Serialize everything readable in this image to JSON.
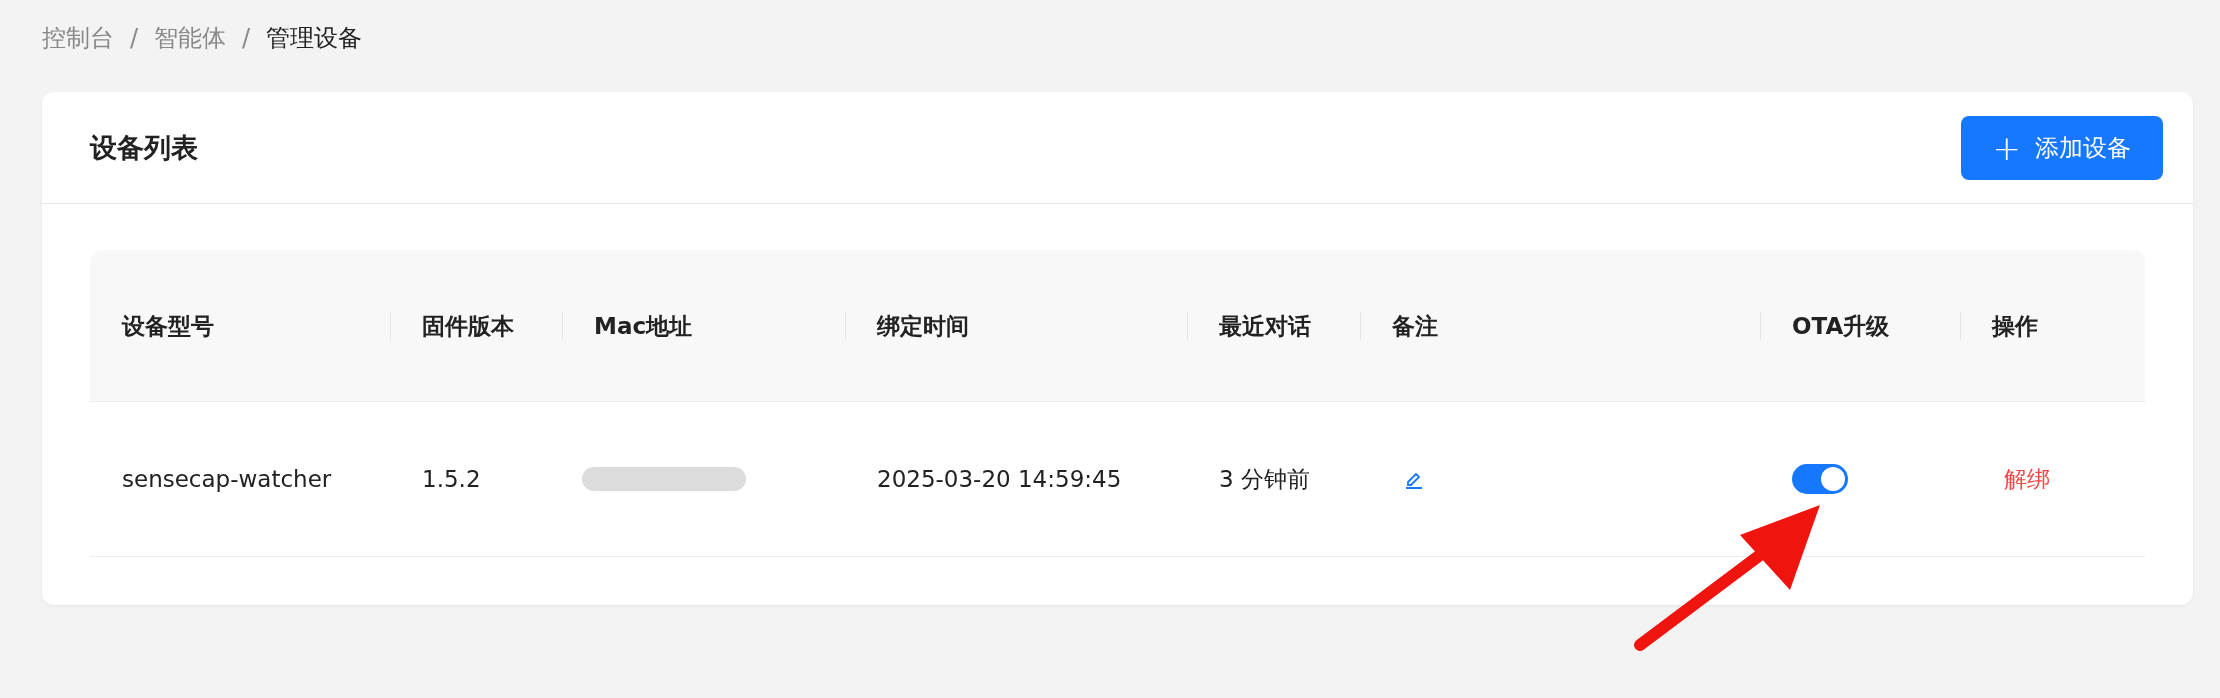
{
  "breadcrumb": [
    {
      "label": "控制台",
      "current": false
    },
    {
      "label": "智能体",
      "current": false
    },
    {
      "label": "管理设备",
      "current": true
    }
  ],
  "separator": "/",
  "card": {
    "title": "设备列表",
    "add_button": {
      "icon": "+",
      "label": "添加设备"
    }
  },
  "table": {
    "columns": [
      "设备型号",
      "固件版本",
      "Mac地址",
      "绑定时间",
      "最近对话",
      "备注",
      "OTA升级",
      "操作"
    ],
    "rows": [
      {
        "cells": [
          {
            "kind": "text",
            "text": "sensecap-watcher"
          },
          {
            "kind": "text",
            "text": "1.5.2"
          },
          {
            "kind": "redacted"
          },
          {
            "kind": "text",
            "text": "2025-03-20 14:59:45"
          },
          {
            "kind": "text",
            "text": "3 分钟前"
          },
          {
            "kind": "edit"
          },
          {
            "kind": "toggle",
            "on": true
          },
          {
            "kind": "link",
            "text": "解绑"
          }
        ]
      }
    ]
  },
  "annotation": {
    "kind": "arrow"
  }
}
